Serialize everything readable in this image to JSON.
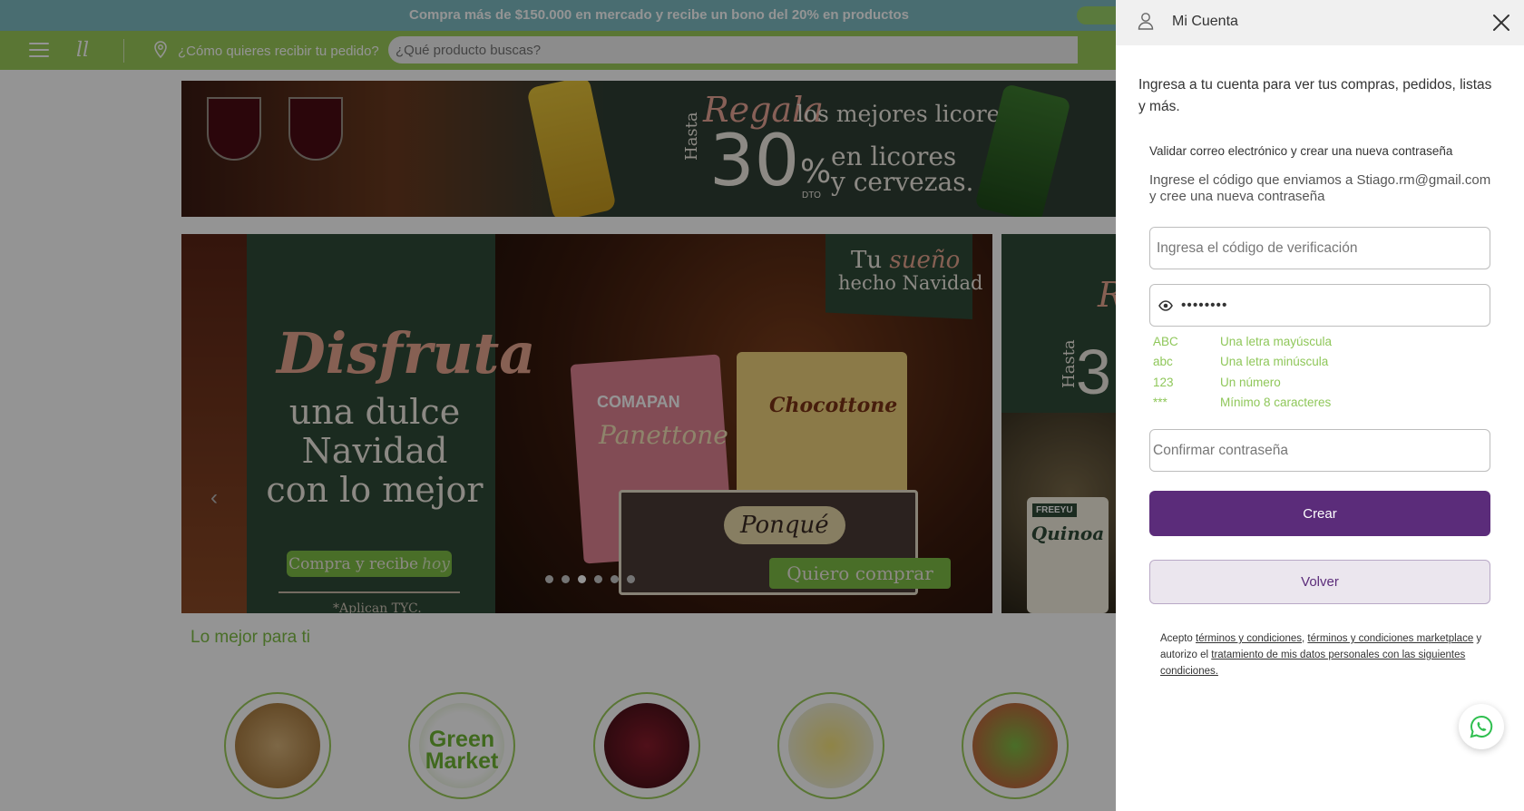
{
  "promo": {
    "text": "Compra más de $150.000 en mercado y recibe un bono del 20% en productos"
  },
  "nav": {
    "delivery_prompt": "¿Cómo quieres recibir tu pedido?",
    "search_placeholder": "¿Qué producto buscas?",
    "logo_glyph": "ll"
  },
  "banner_top": {
    "regala": "Regala",
    "headline": "los mejores licores",
    "hasta": "Hasta",
    "discount": "30",
    "percent": "%",
    "dto": "DTO",
    "line1": "en licores",
    "line2": "y cervezas."
  },
  "banner_main": {
    "disfruta": "Disfruta",
    "line1": "una dulce",
    "line2": "Navidad",
    "line3": "con lo mejor",
    "cta_a": "Compra y recibe",
    "cta_b": "hoy",
    "terms": "*Aplican TYC.",
    "sueno_a": "Tu",
    "sueno_b": "sueño",
    "sueno_c": "hecho Navidad",
    "brand_1": "COMAPAN",
    "product_1": "Panettone",
    "product_2": "Chocottone",
    "product_3": "Ponqué",
    "cta_buy": "Quiero comprar",
    "slides": 6,
    "active_slide": 3
  },
  "banner_side": {
    "r": "R",
    "hasta": "Hasta",
    "three": "3",
    "brand": "FREEYU",
    "product": "Quinoa"
  },
  "section": {
    "title": "Lo mejor para ti"
  },
  "categories": [
    {
      "label": ""
    },
    {
      "label": "Green Market"
    },
    {
      "label": ""
    },
    {
      "label": ""
    },
    {
      "label": ""
    }
  ],
  "panel": {
    "title": "Mi Cuenta",
    "intro": "Ingresa a tu cuenta para ver tus compras, pedidos, listas y más.",
    "validate_title": "Validar correo electrónico y crear una nueva contraseña",
    "validate_desc": "Ingrese el código que enviamos a Stiago.rm@gmail.com y cree una nueva contraseña",
    "code_placeholder": "Ingresa el código de verificación",
    "password_value": "••••••••",
    "rules": [
      {
        "key": "ABC",
        "text": "Una letra mayúscula"
      },
      {
        "key": "abc",
        "text": "Una letra minúscula"
      },
      {
        "key": "123",
        "text": "Un número"
      },
      {
        "key": "***",
        "text": "Mínimo 8 caracteres"
      }
    ],
    "confirm_placeholder": "Confirmar contraseña",
    "create_label": "Crear",
    "back_label": "Volver",
    "legal": {
      "prefix": "Acepto",
      "link1": "términos y condiciones",
      "comma": ",",
      "link2": "términos y condiciones marketplace",
      "middle": "y autorizo el",
      "link3": "tratamiento de mis datos personales con las siguientes condiciones."
    }
  },
  "colors": {
    "primary": "#5b2c7a",
    "accent_green": "#8fc75a",
    "nav_green": "#9bcc5a",
    "promo_teal": "#7fbcc3"
  }
}
